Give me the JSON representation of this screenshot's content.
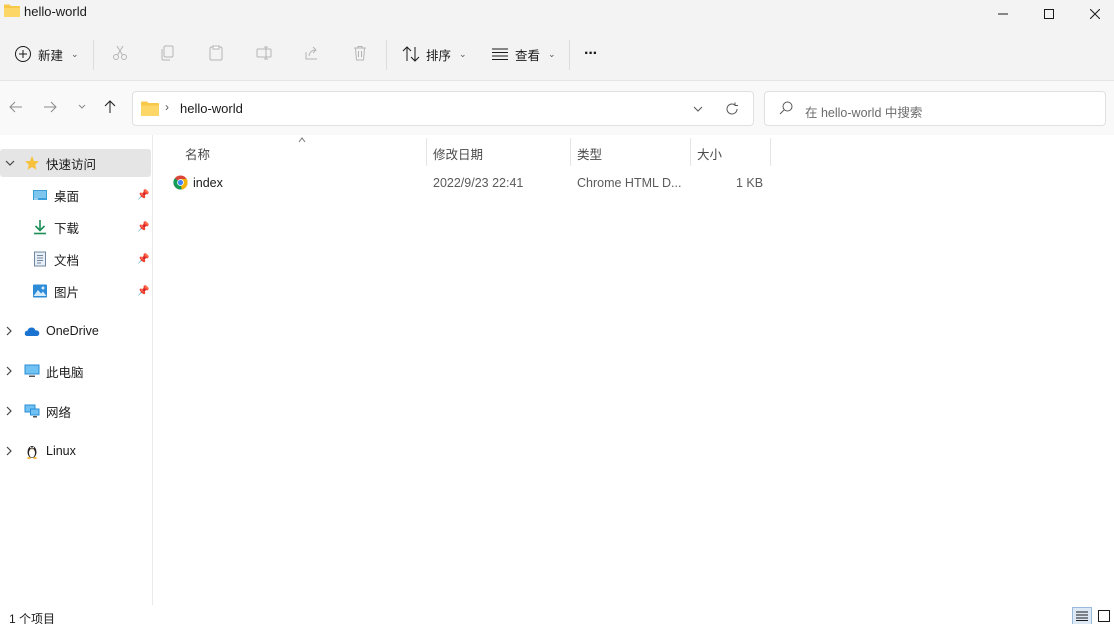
{
  "window": {
    "title": "hello-world"
  },
  "toolbar": {
    "new_label": "新建",
    "sort_label": "排序",
    "view_label": "查看",
    "more_label": "···"
  },
  "address": {
    "path": "hello-world",
    "search_placeholder": "在 hello-world 中搜索"
  },
  "sidebar": {
    "quick_access": "快速访问",
    "pinned": [
      "桌面",
      "下载",
      "文档",
      "图片"
    ],
    "onedrive": "OneDrive",
    "this_pc": "此电脑",
    "network": "网络",
    "linux": "Linux"
  },
  "columns": {
    "name": "名称",
    "modified": "修改日期",
    "type": "类型",
    "size": "大小"
  },
  "files": [
    {
      "name": "index",
      "modified": "2022/9/23 22:41",
      "type": "Chrome HTML D...",
      "size": "1 KB"
    }
  ],
  "status": {
    "item_count": "1 个项目"
  },
  "colors": {
    "accent": "#0067c0",
    "folder": "#f8c84a",
    "selected": "#e5e5e5"
  }
}
